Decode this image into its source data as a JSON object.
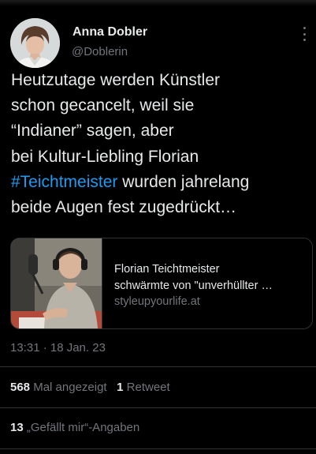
{
  "author": {
    "name": "Anna Dobler",
    "handle": "@Doblerin"
  },
  "tweet": {
    "lines": [
      "Heutzutage werden Künstler",
      "schon gecancelt, weil sie",
      "“Indianer” sagen, aber",
      "bei Kultur-Liebling Florian"
    ],
    "hashtag": "#Teichtmeister",
    "line5_rest": " wurden jahrelang",
    "line6": "beide Augen fest zugedrückt…"
  },
  "card": {
    "title_line1": "Florian Teichtmeister",
    "title_line2": "schwärmte von \"unverhüllter …",
    "domain": "styleupyourlife.at"
  },
  "timestamp": "13:31 · 18 Jan. 23",
  "stats": {
    "views_count": "568",
    "views_label": "Mal angezeigt",
    "retweets_count": "1",
    "retweets_label": "Retweet",
    "likes_count": "13",
    "likes_label": "„Gefällt mir“-Angaben"
  },
  "colors": {
    "background": "#000000",
    "text": "#e7e9ea",
    "secondary": "#71767b",
    "hashtag": "#1d9bf0",
    "border": "#2f3336"
  },
  "icons": {
    "more": "more-horizontal-icon"
  }
}
